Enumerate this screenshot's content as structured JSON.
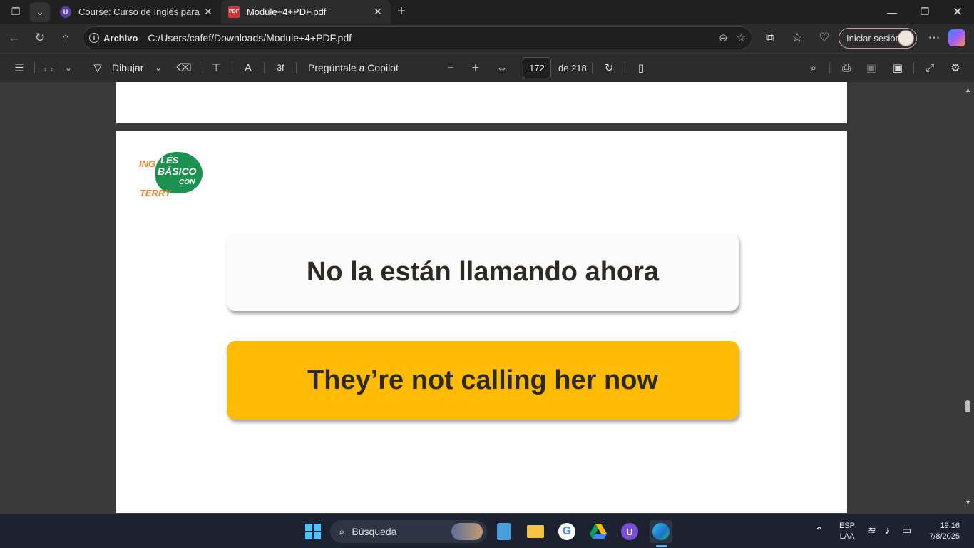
{
  "browser": {
    "tabs": [
      {
        "title": "Course: Curso de Inglés para princ",
        "active": false,
        "favicon": "udemy-icon"
      },
      {
        "title": "Module+4+PDF.pdf",
        "active": true,
        "favicon": "pdf-icon"
      }
    ],
    "address": {
      "site_info": "Archivo",
      "url": "C:/Users/cafef/Downloads/Module+4+PDF.pdf"
    },
    "sign_in_label": "Iniciar sesión"
  },
  "pdf_toolbar": {
    "draw_label": "Dibujar",
    "copilot_label": "Pregúntale a Copilot",
    "current_page": "172",
    "page_total": "de 218"
  },
  "document": {
    "logo": {
      "line1_left": "ING",
      "line1_right": "LÉS",
      "line2": "BÁSICO",
      "line3": "CON",
      "line4": "TERRY"
    },
    "spanish_sentence": "No la están llamando ahora",
    "english_sentence": "They’re not calling her now",
    "colors": {
      "english_card": "#fdbb05",
      "logo_green": "#1d9150",
      "logo_orange": "#ef7d2d"
    }
  },
  "taskbar": {
    "search_placeholder": "Búsqueda",
    "language": "ESP",
    "layout": "LAA",
    "time": "19:16",
    "date": "7/8/2025"
  }
}
